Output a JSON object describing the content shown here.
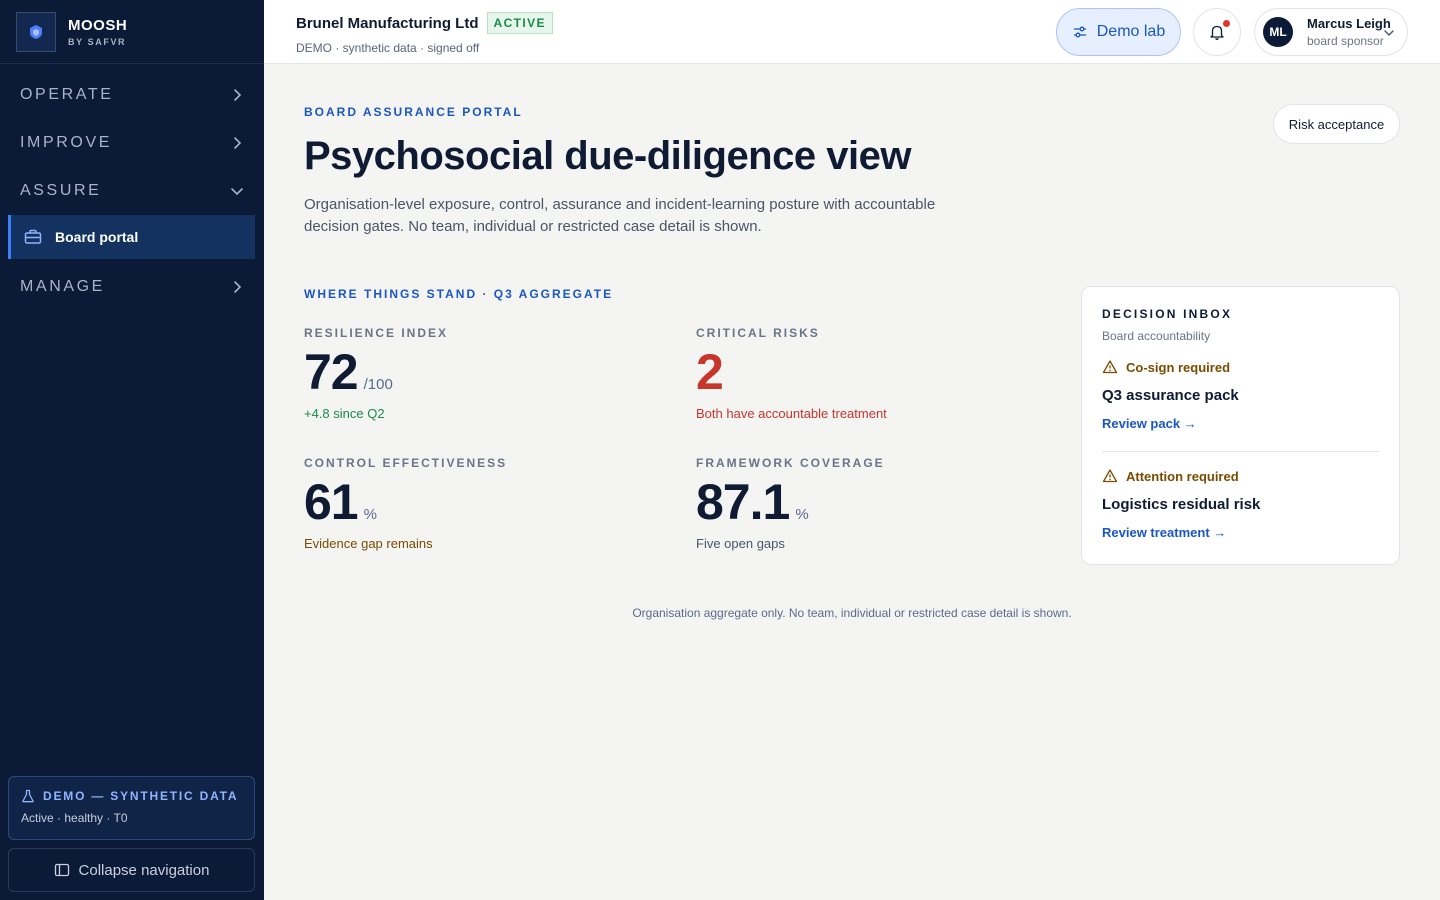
{
  "brand": {
    "name": "MOOSH",
    "sub": "BY SAFVR"
  },
  "sidebar": {
    "sections": [
      {
        "label": "OPERATE"
      },
      {
        "label": "IMPROVE"
      },
      {
        "label": "ASSURE"
      },
      {
        "label": "MANAGE"
      }
    ],
    "active_item": "Board portal",
    "demo_card": {
      "title": "DEMO — SYNTHETIC DATA",
      "status": "Active · healthy · T0"
    },
    "collapse_label": "Collapse navigation"
  },
  "topbar": {
    "org_name": "Brunel Manufacturing Ltd",
    "org_badge": "ACTIVE",
    "org_meta": "DEMO · synthetic data · signed off",
    "demo_lab_label": "Demo lab",
    "user": {
      "initials": "ML",
      "name": "Marcus Leigh",
      "role": "board sponsor"
    }
  },
  "page": {
    "eyebrow": "BOARD ASSURANCE PORTAL",
    "title": "Psychosocial due-diligence view",
    "description": "Organisation-level exposure, control, assurance and incident-learning posture with accountable decision gates. No team, individual or restricted case detail is shown.",
    "risk_button": "Risk acceptance",
    "stand_label": "WHERE THINGS STAND · Q3 AGGREGATE"
  },
  "metrics": {
    "resilience": {
      "label": "RESILIENCE INDEX",
      "value": "72",
      "unit": "/100",
      "note": "+4.8 since Q2"
    },
    "critical": {
      "label": "CRITICAL RISKS",
      "value": "2",
      "unit": "",
      "note": "Both have accountable treatment"
    },
    "control": {
      "label": "CONTROL EFFECTIVENESS",
      "value": "61",
      "unit": "%",
      "note": "Evidence gap remains"
    },
    "coverage": {
      "label": "FRAMEWORK COVERAGE",
      "value": "87.1",
      "unit": "%",
      "note": "Five open gaps"
    }
  },
  "inbox": {
    "title": "DECISION INBOX",
    "subtitle": "Board accountability",
    "items": [
      {
        "flag": "Co-sign required",
        "heading": "Q3 assurance pack",
        "link": "Review pack →"
      },
      {
        "flag": "Attention required",
        "heading": "Logistics residual risk",
        "link": "Review treatment →"
      }
    ]
  },
  "footnote": "Organisation aggregate only. No team, individual or restricted case detail is shown.",
  "colors": {
    "sidebar_bg": "#0b1a36",
    "accent": "#1a56c4",
    "critical": "#c7352b",
    "positive": "#1a8a4a",
    "warning": "#7a4b00"
  },
  "icons": {
    "brand": "shield-logo-icon",
    "chevron_right": "chevron-right-icon",
    "chevron_down": "chevron-down-icon",
    "board_portal": "briefcase-icon",
    "demo": "flask-icon",
    "collapse": "sidebar-panel-icon",
    "demo_lab": "sliders-icon",
    "bell": "bell-icon",
    "warning": "warning-triangle-icon"
  }
}
